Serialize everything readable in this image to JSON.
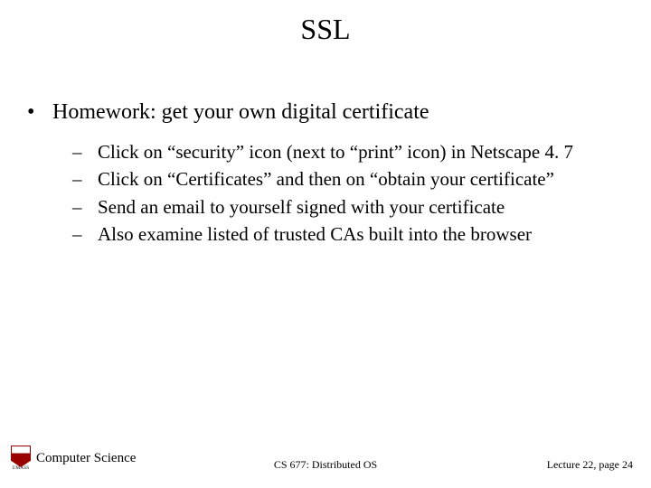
{
  "title": "SSL",
  "main_bullet": "Homework: get your own digital certificate",
  "sub_bullets": [
    "Click on “security” icon (next to “print” icon) in Netscape 4. 7",
    "Click on “Certificates” and then on “obtain your certificate”",
    "Send an email to yourself signed with your certificate",
    "Also examine listed of trusted CAs built into the browser"
  ],
  "footer": {
    "left": "Computer Science",
    "logo_label": "UMASS",
    "center": "CS 677: Distributed OS",
    "right": "Lecture 22, page 24"
  }
}
